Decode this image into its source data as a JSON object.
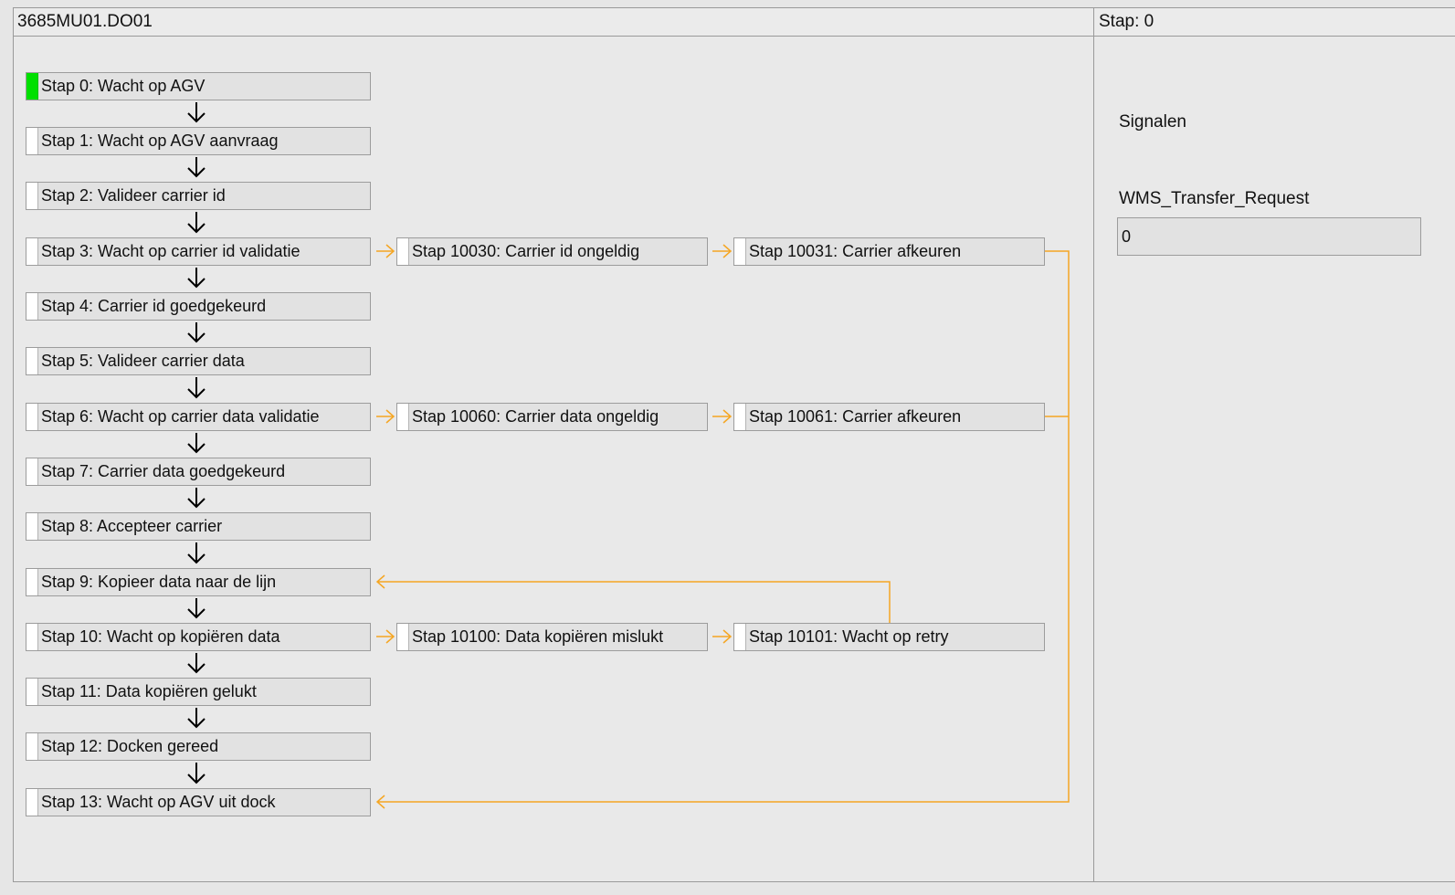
{
  "header": {
    "title": "3685MU01.DO01",
    "stap_status": "Stap: 0"
  },
  "signals": {
    "title": "Signalen",
    "items": [
      {
        "name": "WMS_Transfer_Request",
        "value": "0"
      }
    ]
  },
  "colors": {
    "active": "#00e000",
    "branch": "#f5a623",
    "arrow": "#000000"
  },
  "steps": {
    "s0": {
      "label": "Stap 0: Wacht op AGV",
      "active": true
    },
    "s1": {
      "label": "Stap 1: Wacht op AGV aanvraag"
    },
    "s2": {
      "label": "Stap 2: Valideer carrier id"
    },
    "s3": {
      "label": "Stap 3: Wacht op carrier id validatie"
    },
    "s4": {
      "label": "Stap 4: Carrier id goedgekeurd"
    },
    "s5": {
      "label": "Stap 5: Valideer carrier data"
    },
    "s6": {
      "label": "Stap 6: Wacht op carrier data validatie"
    },
    "s7": {
      "label": "Stap 7: Carrier data goedgekeurd"
    },
    "s8": {
      "label": "Stap 8: Accepteer carrier"
    },
    "s9": {
      "label": "Stap 9: Kopieer data naar de lijn"
    },
    "s10": {
      "label": "Stap 10: Wacht op kopiëren data"
    },
    "s11": {
      "label": "Stap 11: Data kopiëren gelukt"
    },
    "s12": {
      "label": "Stap 12: Docken gereed"
    },
    "s13": {
      "label": "Stap 13: Wacht op AGV uit dock"
    },
    "s10030": {
      "label": "Stap 10030: Carrier id ongeldig"
    },
    "s10031": {
      "label": "Stap 10031: Carrier afkeuren"
    },
    "s10060": {
      "label": "Stap 10060: Carrier data ongeldig"
    },
    "s10061": {
      "label": "Stap 10061: Carrier afkeuren"
    },
    "s10100": {
      "label": "Stap 10100: Data kopiëren mislukt"
    },
    "s10101": {
      "label": "Stap 10101: Wacht op retry"
    }
  }
}
